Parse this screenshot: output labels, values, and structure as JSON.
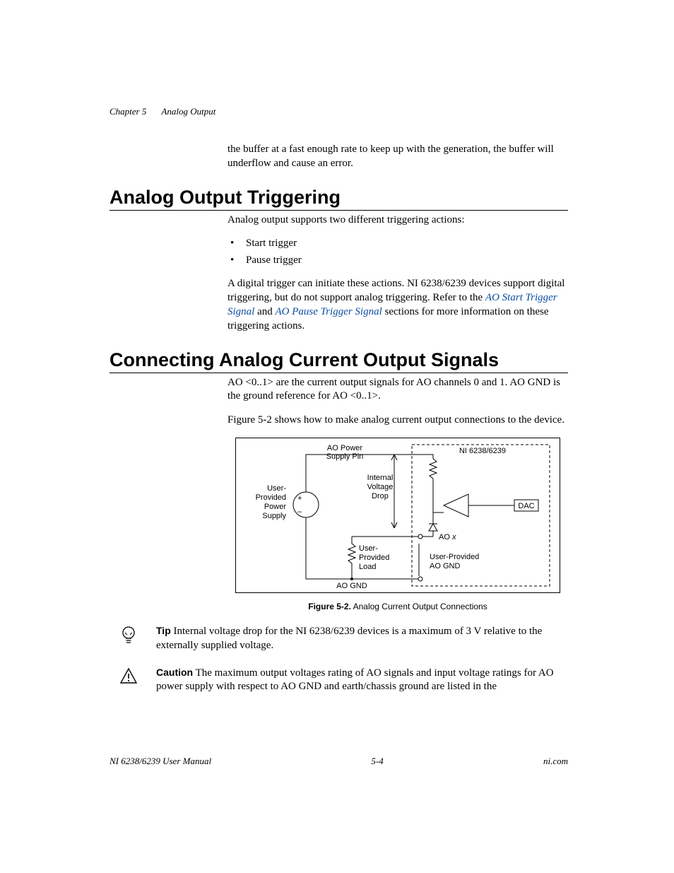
{
  "runningHead": {
    "chapter": "Chapter 5",
    "title": "Analog Output"
  },
  "intro": "the buffer at a fast enough rate to keep up with the generation, the buffer will underflow and cause an error.",
  "sec1": {
    "heading": "Analog Output Triggering",
    "p1": "Analog output supports two different triggering actions:",
    "b1": "Start trigger",
    "b2": "Pause trigger",
    "p2a": "A digital trigger can initiate these actions. NI 6238/6239 devices support digital triggering, but do not support analog triggering. Refer to the ",
    "link1": "AO Start Trigger Signal",
    "p2b": " and ",
    "link2": "AO Pause Trigger Signal",
    "p2c": " sections for more information on these triggering actions."
  },
  "sec2": {
    "heading": "Connecting Analog Current Output Signals",
    "p1": "AO <0..1> are the current output signals for AO channels 0 and 1. AO GND is the ground reference for AO <0..1>.",
    "p2": "Figure 5-2 shows how to make analog current output connections to the device."
  },
  "figure": {
    "captionLabel": "Figure 5-2.",
    "captionText": "  Analog Current Output Connections",
    "labels": {
      "aoPower1": "AO Power",
      "aoPower2": "Supply Pin",
      "userPS1": "User-",
      "userPS2": "Provided",
      "userPS3": "Power",
      "userPS4": "Supply",
      "plus": "+",
      "minus": "–",
      "ivd1": "Internal",
      "ivd2": "Voltage",
      "ivd3": "Drop",
      "ni": "NI 6238/6239",
      "dac": "DAC",
      "aoX": "AO",
      "aoXi": "x",
      "upLoad1": "User-",
      "upLoad2": "Provided",
      "upLoad3": "Load",
      "upAoGnd1": "User-Provided",
      "upAoGnd2": "AO GND",
      "aoGnd": "AO GND"
    }
  },
  "tip": {
    "label": "Tip",
    "text": "   Internal voltage drop for the NI 6238/6239 devices is a maximum of 3 V relative to the externally supplied voltage."
  },
  "caution": {
    "label": "Caution",
    "text": "   The maximum output voltages rating of AO signals and input voltage ratings for AO power supply with respect to AO GND and earth/chassis ground are listed in the"
  },
  "footer": {
    "left": "NI 6238/6239 User Manual",
    "center": "5-4",
    "right": "ni.com"
  }
}
